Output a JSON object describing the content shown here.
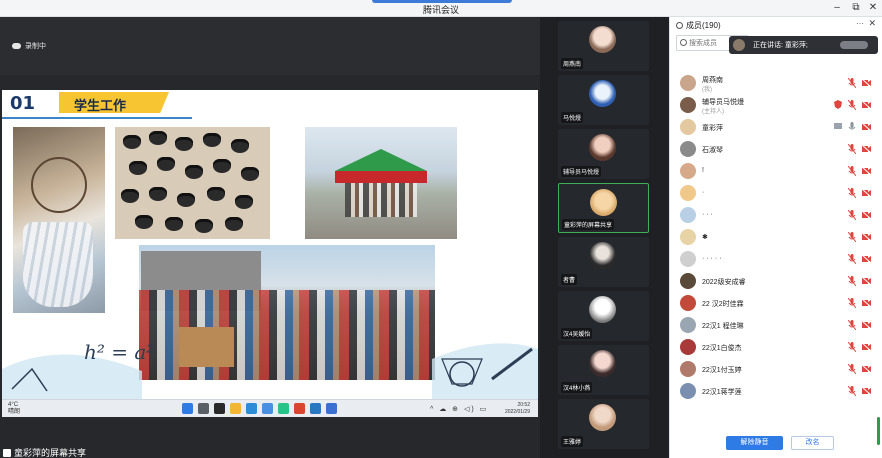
{
  "window": {
    "title": "腾讯会议",
    "controls": {
      "minimize": "–",
      "restore": "⧉",
      "close": "✕"
    }
  },
  "share": {
    "recording_label": "录制中",
    "slide": {
      "number": "01",
      "title": "学生工作",
      "formula": "h² = a²"
    },
    "taskbar": {
      "weather_temp": "4°C",
      "weather_desc": "晴朗",
      "clock_time": "20:52",
      "clock_date": "2022/01/29",
      "tray_text": "^ ☁ ⊕ ◁) ▭"
    },
    "sharer_label": "童彩萍的屏幕共享"
  },
  "tiles": [
    {
      "name": "周燕南"
    },
    {
      "name": "马悦熳"
    },
    {
      "name": "辅导员马悦熳"
    },
    {
      "name": "童彩萍的屏幕共享"
    },
    {
      "name": "者曹"
    },
    {
      "name": "汉4吴媛怡"
    },
    {
      "name": "汉4林小燕"
    },
    {
      "name": "王雅婷"
    }
  ],
  "panel": {
    "title": "成员(190)",
    "more": "···",
    "close": "✕",
    "search_placeholder": "搜索成员",
    "speaking": "正在讲话: 童彩萍;",
    "members": [
      {
        "name": "周燕南",
        "sub": "(我)",
        "color": "#c9a68b"
      },
      {
        "name": "辅导员马悦熳",
        "sub": "(主持人)",
        "color": "#7a5c4a"
      },
      {
        "name": "童彩萍",
        "sub": "",
        "color": "#e3c8a0"
      },
      {
        "name": "石淑琴",
        "sub": "",
        "color": "#8a8a8a"
      },
      {
        "name": "!",
        "sub": "",
        "color": "#d6a98b"
      },
      {
        "name": "·",
        "sub": "",
        "color": "#f0c88a"
      },
      {
        "name": "· · ·",
        "sub": "",
        "color": "#b8cfe6"
      },
      {
        "name": "✱",
        "sub": "",
        "color": "#e8d3a6"
      },
      {
        "name": "· · · · ·",
        "sub": "",
        "color": "#cfcfcf"
      },
      {
        "name": "2022级安成睿",
        "sub": "",
        "color": "#5a4a3a"
      },
      {
        "name": "22 汉2时佳霖",
        "sub": "",
        "color": "#c24a3a"
      },
      {
        "name": "22汉1 程佳琳",
        "sub": "",
        "color": "#9aa6b2"
      },
      {
        "name": "22汉1白俊杰",
        "sub": "",
        "color": "#a83a3a"
      },
      {
        "name": "22汉1付玉婷",
        "sub": "",
        "color": "#b07a6a"
      },
      {
        "name": "22汉1蒋学莲",
        "sub": "",
        "color": "#7a8fb0"
      }
    ],
    "unmute_all": "解除静音",
    "rename": "改名"
  },
  "colors": {
    "accent": "#2f7be5",
    "active_speaker": "#3fae5a",
    "mic_muted": "#e0443e",
    "slide_bar": "#f6c531"
  }
}
